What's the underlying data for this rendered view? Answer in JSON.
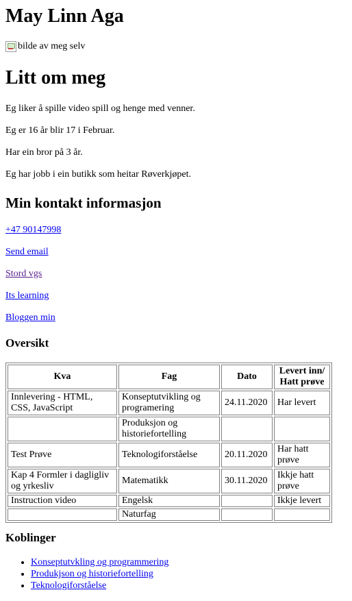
{
  "header": {
    "name": "May Linn Aga",
    "image_alt": "bilde av meg selv"
  },
  "about": {
    "title": "Litt om meg",
    "paragraphs": [
      "Eg liker å spille video spill og henge med venner.",
      "Eg er 16 år blir 17 i Februar.",
      "Har ein bror på 3 år.",
      "Eg har jobb i ein butikk som heitar Røverkjøpet."
    ]
  },
  "contact": {
    "title": "Min kontakt informasjon",
    "links": [
      "+47 90147998",
      "Send email",
      "Stord vgs",
      "Its learning",
      "Bloggen min"
    ]
  },
  "overview": {
    "title": "Oversikt",
    "headers": [
      "Kva",
      "Fag",
      "Dato",
      "Levert inn/ Hatt prøve"
    ],
    "rows": [
      [
        "Innlevering - HTML, CSS, JavaScript",
        "Konseptutvikling og programering",
        "24.11.2020",
        "Har levert"
      ],
      [
        "",
        "Produksjon og historiefortelling",
        "",
        ""
      ],
      [
        "Test Prøve",
        "Teknologiforståelse",
        "20.11.2020",
        "Har hatt prøve"
      ],
      [
        "Kap 4 Formler i dagligliv og yrkesliv",
        "Matematikk",
        "30.11.2020",
        "Ikkje hatt prøve"
      ],
      [
        "Instruction video",
        "Engelsk",
        "",
        "Ikkje levert"
      ],
      [
        "",
        "Naturfag",
        "",
        ""
      ]
    ]
  },
  "koblinger": {
    "title": "Koblinger",
    "links": [
      "Konseptutvkling og programmering",
      "Produkjson og historiefortelling",
      "Teknologiforståelse"
    ]
  },
  "colors": {
    "link": "#0000ee",
    "visited_link": "#551a8b",
    "table_border": "#808080"
  }
}
